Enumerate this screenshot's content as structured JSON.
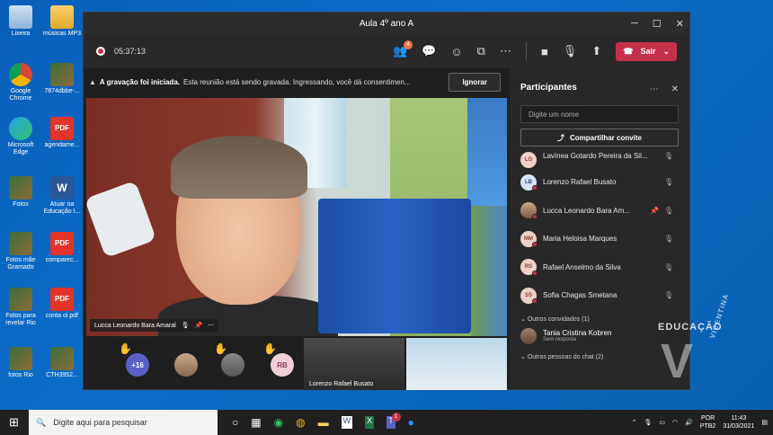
{
  "desktop": {
    "icons": [
      {
        "label": "Lixeira",
        "kind": "bin"
      },
      {
        "label": "músicas MP3",
        "kind": "folder"
      },
      {
        "label": "Google Chrome",
        "kind": "chrome"
      },
      {
        "label": "7874dbbe-...",
        "kind": "photo"
      },
      {
        "label": "Microsoft Edge",
        "kind": "edge"
      },
      {
        "label": "agendame...",
        "kind": "pdf"
      },
      {
        "label": "Fotos",
        "kind": "photo"
      },
      {
        "label": "Atuar na Educação I...",
        "kind": "word"
      },
      {
        "label": "Fotos mãe Gramado",
        "kind": "photo"
      },
      {
        "label": "comparec...",
        "kind": "pdf"
      },
      {
        "label": "Fotos para revelar Rio",
        "kind": "photo"
      },
      {
        "label": "conta oi.pdf",
        "kind": "pdf"
      },
      {
        "label": "fotos Rio",
        "kind": "photo"
      },
      {
        "label": "CTH3952...",
        "kind": "photo"
      }
    ],
    "pdf_text": "PDF"
  },
  "window": {
    "title": "Aula 4º ano A",
    "timer": "05:37:13",
    "participant_badge": "4",
    "leave_label": "Sair"
  },
  "notice": {
    "bold": "A gravação foi iniciada.",
    "text": "Esta reunião está sendo gravada. Ingressando, você dá consentimen...",
    "ignore_label": "Ignorar"
  },
  "stage": {
    "speaker_name": "Lucca Leonardo Bara Amaral"
  },
  "strip": {
    "more_count": "+16",
    "rb_initials": "RB",
    "thumb1_name": "Lorenzo Rafael Busato"
  },
  "panel": {
    "title": "Participantes",
    "search_placeholder": "Digite um nome",
    "share_label": "Compartilhar convite",
    "participants": [
      {
        "initials": "LG",
        "name": "Lavínea Gotardo Pereira da Sil..."
      },
      {
        "initials": "LB",
        "name": "Lorenzo Rafael Busato"
      },
      {
        "initials": "",
        "name": "Lucca Leonardo Bara Am..."
      },
      {
        "initials": "MM",
        "name": "Maria Heloisa Marques"
      },
      {
        "initials": "RS",
        "name": "Rafael Anselmo da Silva"
      },
      {
        "initials": "SS",
        "name": "Sofia Chagas Smetana"
      }
    ],
    "invited_header": "Outros convidados (1)",
    "guest_name": "Tania Cristina Kobren",
    "guest_status": "Sem resposta",
    "others_header": "Outras pessoas do chat (2)"
  },
  "taskbar": {
    "search_placeholder": "Digite aqui para pesquisar",
    "lang": "POR",
    "layout": "PTB2",
    "time": "11:43",
    "date": "31/03/2021",
    "teams_badge": "1"
  },
  "watermark": {
    "title": "EDUCAÇÃO",
    "sub": "VICENTINA"
  },
  "colors": {
    "accent_red": "#c4314b",
    "desktop_blue": "#0b6cc9",
    "teams_dark": "#1f1f1f"
  }
}
